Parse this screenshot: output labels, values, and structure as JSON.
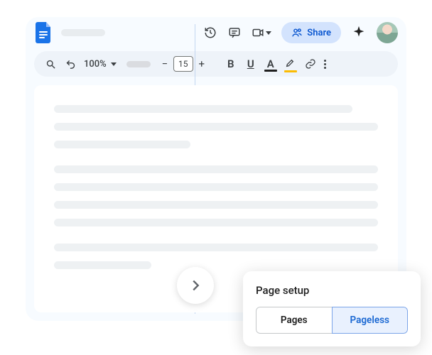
{
  "header": {
    "share_label": "Share"
  },
  "toolbar": {
    "zoom": "100%",
    "font_size": "15",
    "minus": "−",
    "plus": "+",
    "bold": "B",
    "underline": "U",
    "text_color_letter": "A",
    "text_color_underline": "#1f1f1f",
    "highlight_color_underline": "#fbbc04"
  },
  "popover": {
    "title": "Page setup",
    "option_pages": "Pages",
    "option_pageless": "Pageless"
  }
}
